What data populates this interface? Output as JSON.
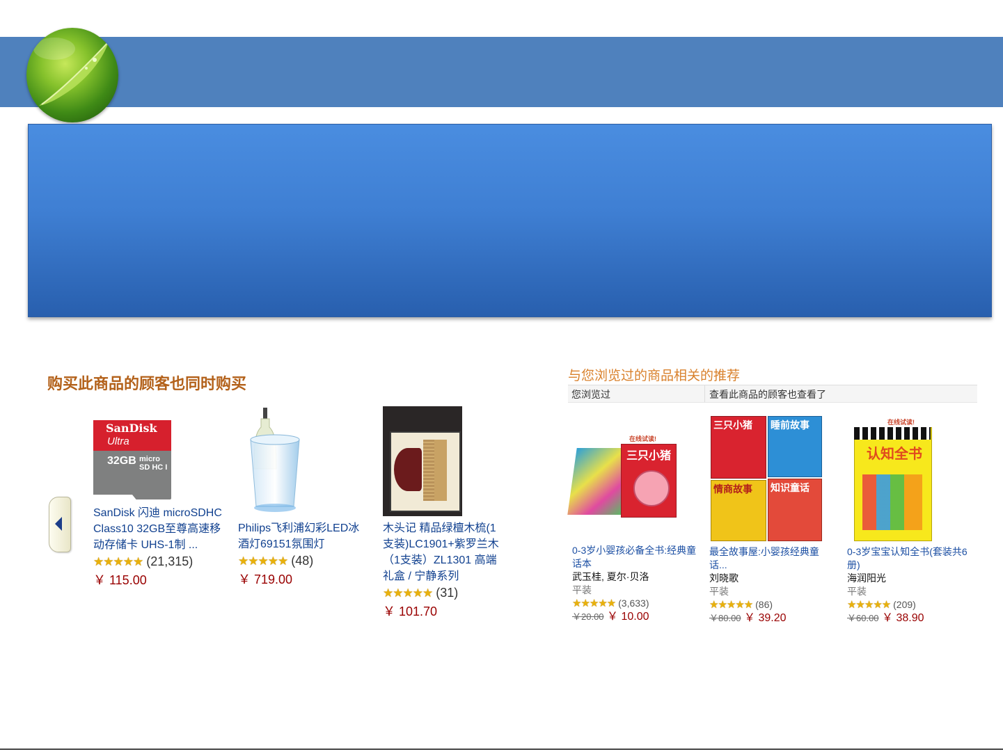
{
  "colors": {
    "band": "#4f81bd",
    "box": "#3f7fd3",
    "section_title": "#b3611a",
    "link": "#10408f",
    "price": "#990000"
  },
  "left_panel": {
    "title": "购买此商品的顾客也同时购买",
    "products": [
      {
        "title": "SanDisk 闪迪 microSDHC Class10 32GB至尊高速移动存储卡 UHS-1制 ...",
        "reviews": "(21,315)",
        "price": "￥ 115.00",
        "image_text_brand": "SanDisk",
        "image_text_line": "Ultra",
        "image_text_cap": "32GB",
        "icon": "sd-card-icon"
      },
      {
        "title": "Philips飞利浦幻彩LED冰酒灯69151氛围灯",
        "reviews": "(48)",
        "price": "￥ 719.00",
        "icon": "wine-bucket-icon"
      },
      {
        "title": "木头记 精品绿檀木梳(1支装)LC1901+紫罗兰木（1支装）ZL1301 高端礼盒 / 宁静系列",
        "reviews": "(31)",
        "price": "￥ 101.70",
        "icon": "wooden-comb-icon"
      }
    ]
  },
  "right_panel": {
    "title": "与您浏览过的商品相关的推荐",
    "tabs": [
      "您浏览过",
      "查看此商品的顾客也查看了"
    ],
    "badge": "在线试读!",
    "products": [
      {
        "title": "0-3岁小婴孩必备全书:经典童话本",
        "author": "武玉桂, 夏尔·贝洛",
        "format": "平装",
        "reviews": "(3,633)",
        "list_price": "￥20.00",
        "price": "￥ 10.00",
        "cover_text": "三只小猪"
      },
      {
        "title": "最全故事屋:小婴孩经典童话...",
        "author": "刘晓歌",
        "format": "平装",
        "reviews": "(86)",
        "list_price": "￥80.00",
        "price": "￥ 39.20",
        "covers": [
          "三只小猪",
          "睡前故事",
          "情商故事",
          "知识童话"
        ]
      },
      {
        "title": "0-3岁宝宝认知全书(套装共6册)",
        "author": "海润阳光",
        "format": "平装",
        "reviews": "(209)",
        "list_price": "￥60.00",
        "price": "￥ 38.90",
        "cover_text": "认知全书"
      }
    ]
  },
  "stars_glyph": "★★★★★"
}
